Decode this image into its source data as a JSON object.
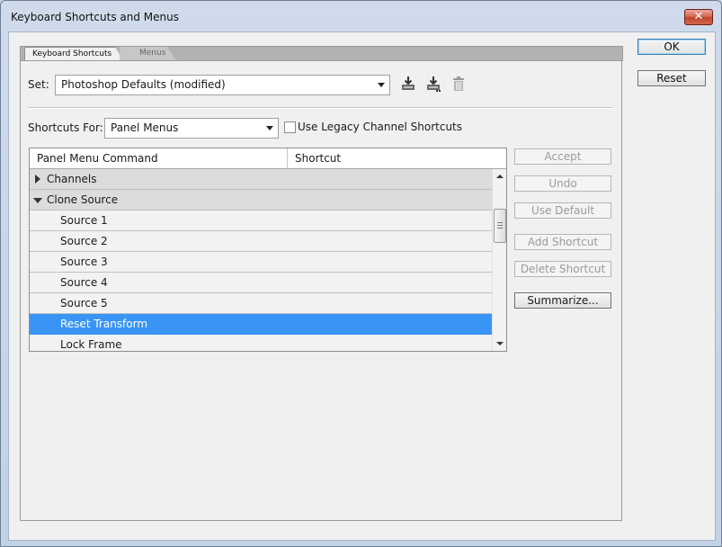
{
  "window": {
    "title": "Keyboard Shortcuts and Menus",
    "close_label": "✕"
  },
  "tabs": [
    {
      "label": "Keyboard Shortcuts",
      "active": true
    },
    {
      "label": "Menus",
      "active": false
    }
  ],
  "set": {
    "label": "Set:",
    "value": "Photoshop Defaults (modified)"
  },
  "toolbar_icons": [
    "save-set-icon",
    "save-as-set-icon",
    "delete-set-icon"
  ],
  "shortcuts_for": {
    "label": "Shortcuts For:",
    "value": "Panel Menus"
  },
  "legacy_checkbox": {
    "label": "Use Legacy Channel Shortcuts",
    "checked": false
  },
  "table": {
    "columns": [
      "Panel Menu Command",
      "Shortcut"
    ],
    "rows": [
      {
        "type": "group",
        "label": "Channels",
        "expanded": false,
        "shortcut": ""
      },
      {
        "type": "group",
        "label": "Clone Source",
        "expanded": true,
        "shortcut": ""
      },
      {
        "type": "item",
        "label": "Source 1",
        "shortcut": ""
      },
      {
        "type": "item",
        "label": "Source 2",
        "shortcut": ""
      },
      {
        "type": "item",
        "label": "Source 3",
        "shortcut": ""
      },
      {
        "type": "item",
        "label": "Source 4",
        "shortcut": ""
      },
      {
        "type": "item",
        "label": "Source 5",
        "shortcut": ""
      },
      {
        "type": "item",
        "label": "Reset Transform",
        "shortcut": "",
        "selected": true
      },
      {
        "type": "item",
        "label": "Lock Frame",
        "shortcut": ""
      }
    ]
  },
  "side_buttons": [
    {
      "label": "Accept",
      "enabled": false
    },
    {
      "label": "Undo",
      "enabled": false
    },
    {
      "label": "Use Default",
      "enabled": false
    },
    {
      "label": "Add Shortcut",
      "enabled": false
    },
    {
      "label": "Delete Shortcut",
      "enabled": false
    },
    {
      "label": "Summarize...",
      "enabled": true
    }
  ],
  "dialog_buttons": {
    "ok": "OK",
    "reset": "Reset"
  },
  "colors": {
    "selection": "#3895f5",
    "group_row": "#dcdcdc",
    "item_row": "#f2f2f2"
  }
}
